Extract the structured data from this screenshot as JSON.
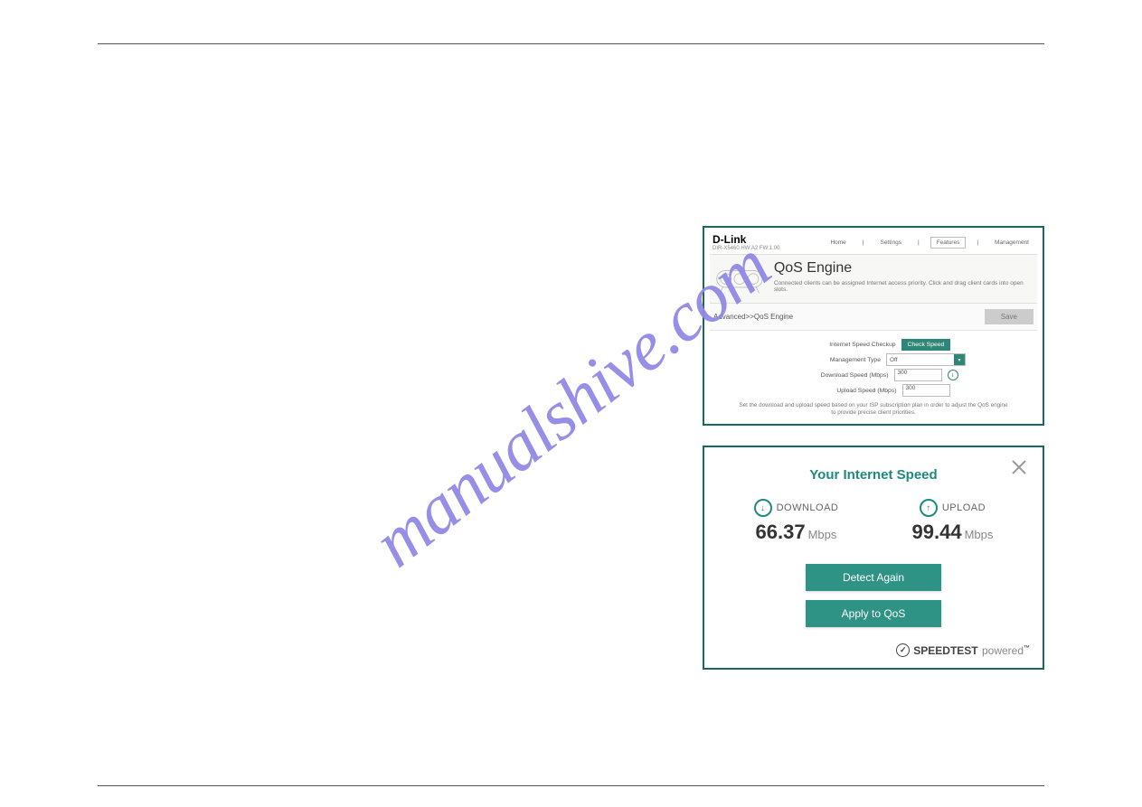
{
  "watermark": "manualshive.com",
  "router": {
    "brand": "D-Link",
    "model_line": "DIR-X5460 HW:A2 FW:1.00",
    "nav": {
      "home": "Home",
      "settings": "Settings",
      "features": "Features",
      "management": "Management"
    },
    "hero_title": "QoS Engine",
    "hero_desc": "Connected clients can be assigned Internet access priority. Click and drag client cards into open slots.",
    "breadcrumb": "Advanced>>QoS Engine",
    "save_btn": "Save",
    "form": {
      "checkup_label": "Internet Speed Checkup",
      "checkup_btn": "Check Speed",
      "mgmt_label": "Management Type",
      "mgmt_value": "Off",
      "dl_label": "Download Speed (Mbps)",
      "dl_value": "300",
      "ul_label": "Upload Speed (Mbps)",
      "ul_value": "300",
      "note": "Set the download and upload speed based on your ISP subscription plan in order to adjust the QoS engine to provide precise client priorities."
    }
  },
  "speed": {
    "title": "Your Internet Speed",
    "download_label": "DOWNLOAD",
    "download_value": "66.37",
    "upload_label": "UPLOAD",
    "upload_value": "99.44",
    "unit": "Mbps",
    "detect_btn": "Detect Again",
    "apply_btn": "Apply to QoS",
    "powered_brand": "SPEEDTEST",
    "powered_suffix": "powered"
  }
}
